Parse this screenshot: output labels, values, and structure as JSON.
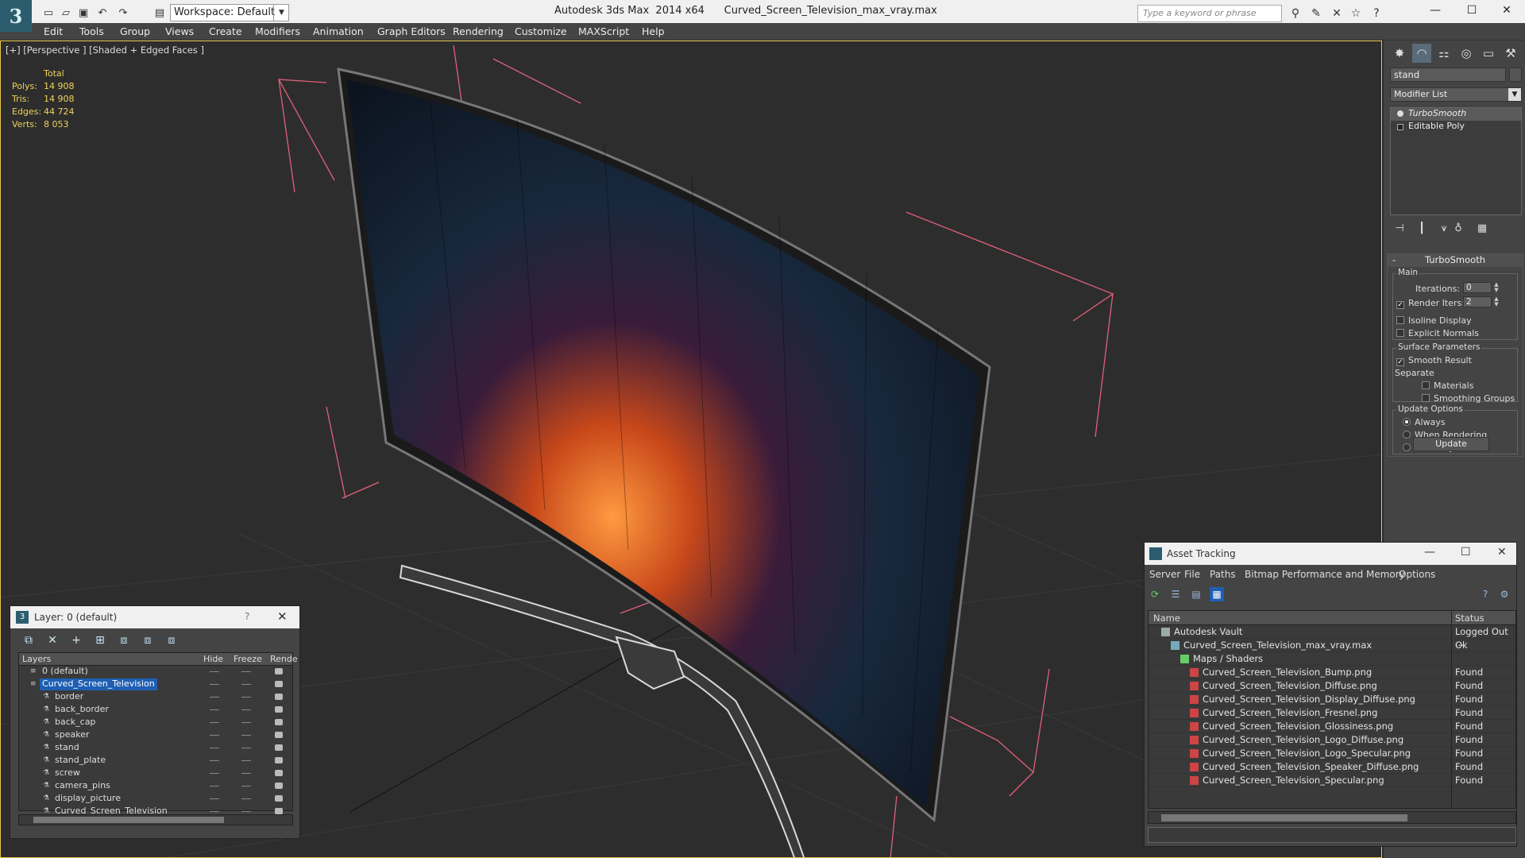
{
  "titlebar": {
    "title": "Autodesk 3ds Max  2014 x64      Curved_Screen_Television_max_vray.max",
    "workspace_label": "Workspace: Default",
    "search_placeholder": "Type a keyword or phrase",
    "logo_letter": "3"
  },
  "menu": [
    "Edit",
    "Tools",
    "Group",
    "Views",
    "Create",
    "Modifiers",
    "Animation",
    "Graph Editors",
    "Rendering",
    "Customize",
    "MAXScript",
    "Help"
  ],
  "viewport": {
    "label": "[+] [Perspective ] [Shaded + Edged Faces ]",
    "stats": {
      "header": "Total",
      "polys_label": "Polys:",
      "polys": "14 908",
      "tris_label": "Tris:",
      "tris": "14 908",
      "edges_label": "Edges:",
      "edges": "44 724",
      "verts_label": "Verts:",
      "verts": "8 053"
    }
  },
  "command_panel": {
    "object_name": "stand",
    "modifier_list": "Modifier List",
    "stack": [
      "TurboSmooth",
      "Editable Poly"
    ],
    "turbosmooth": {
      "title": "TurboSmooth",
      "main_group": "Main",
      "iterations_label": "Iterations:",
      "iterations": "0",
      "render_iters_label": "Render Iters:",
      "render_iters": "2",
      "render_iters_checked": true,
      "isoline_label": "Isoline Display",
      "explicit_label": "Explicit Normals",
      "surface_group": "Surface Parameters",
      "smooth_result_label": "Smooth Result",
      "separate_label": "Separate",
      "materials_label": "Materials",
      "smoothing_groups_label": "Smoothing Groups",
      "update_group": "Update Options",
      "always_label": "Always",
      "when_rendering_label": "When Rendering",
      "manually_label": "Manually",
      "update_button": "Update"
    }
  },
  "layer_dialog": {
    "title": "Layer: 0 (default)",
    "help": "?",
    "columns": [
      "Layers",
      "Hide",
      "Freeze",
      "Rende"
    ],
    "rows": [
      {
        "name": "0 (default)",
        "level": 0
      },
      {
        "name": "Curved_Screen_Television",
        "level": 0,
        "selected": true
      },
      {
        "name": "border",
        "level": 1
      },
      {
        "name": "back_border",
        "level": 1
      },
      {
        "name": "back_cap",
        "level": 1
      },
      {
        "name": "speaker",
        "level": 1
      },
      {
        "name": "stand",
        "level": 1
      },
      {
        "name": "stand_plate",
        "level": 1
      },
      {
        "name": "screw",
        "level": 1
      },
      {
        "name": "camera_pins",
        "level": 1
      },
      {
        "name": "display_picture",
        "level": 1
      },
      {
        "name": "Curved_Screen_Television",
        "level": 1
      }
    ]
  },
  "asset_tracking": {
    "title": "Asset Tracking",
    "menu": [
      "Server",
      "File",
      "Paths",
      "Bitmap Performance and Memory",
      "Options"
    ],
    "columns": [
      "Name",
      "Status"
    ],
    "rows": [
      {
        "name": "Autodesk Vault",
        "status": "Logged Out ...",
        "level": 0,
        "icon": "vault"
      },
      {
        "name": "Curved_Screen_Television_max_vray.max",
        "status": "Ok",
        "level": 1,
        "icon": "max"
      },
      {
        "name": "Maps / Shaders",
        "status": "",
        "level": 2,
        "icon": "maps"
      },
      {
        "name": "Curved_Screen_Television_Bump.png",
        "status": "Found",
        "level": 3,
        "icon": "png"
      },
      {
        "name": "Curved_Screen_Television_Diffuse.png",
        "status": "Found",
        "level": 3,
        "icon": "png"
      },
      {
        "name": "Curved_Screen_Television_Display_Diffuse.png",
        "status": "Found",
        "level": 3,
        "icon": "png"
      },
      {
        "name": "Curved_Screen_Television_Fresnel.png",
        "status": "Found",
        "level": 3,
        "icon": "png"
      },
      {
        "name": "Curved_Screen_Television_Glossiness.png",
        "status": "Found",
        "level": 3,
        "icon": "png"
      },
      {
        "name": "Curved_Screen_Television_Logo_Diffuse.png",
        "status": "Found",
        "level": 3,
        "icon": "png"
      },
      {
        "name": "Curved_Screen_Television_Logo_Specular.png",
        "status": "Found",
        "level": 3,
        "icon": "png"
      },
      {
        "name": "Curved_Screen_Television_Speaker_Diffuse.png",
        "status": "Found",
        "level": 3,
        "icon": "png"
      },
      {
        "name": "Curved_Screen_Television_Specular.png",
        "status": "Found",
        "level": 3,
        "icon": "png"
      }
    ]
  },
  "colors": {
    "accent": "#1e5fb3",
    "stats_text": "#f0d35a",
    "bbox_lines": "#e0607a",
    "viewport_border": "#e8c84a"
  }
}
